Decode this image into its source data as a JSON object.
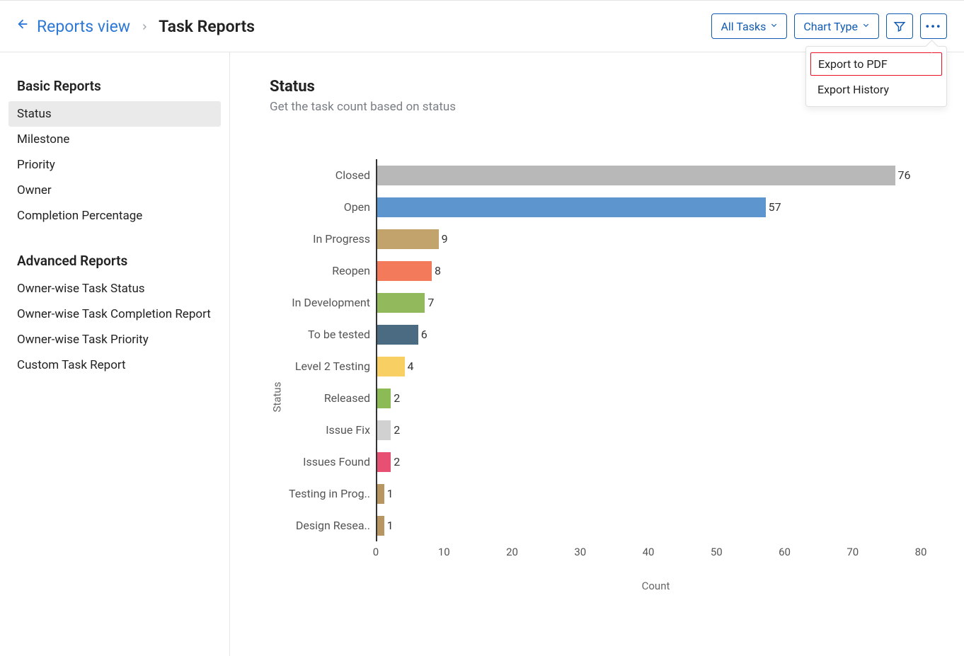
{
  "header": {
    "breadcrumb_link": "Reports view",
    "page_title": "Task Reports",
    "actions": {
      "all_tasks": "All Tasks",
      "chart_type": "Chart Type"
    },
    "menu": {
      "export_pdf": "Export to PDF",
      "export_history": "Export History"
    }
  },
  "sidebar": {
    "groups": [
      {
        "title": "Basic Reports",
        "items": [
          "Status",
          "Milestone",
          "Priority",
          "Owner",
          "Completion Percentage"
        ],
        "active_index": 0
      },
      {
        "title": "Advanced Reports",
        "items": [
          "Owner-wise Task Status",
          "Owner-wise Task Completion Report",
          "Owner-wise Task Priority",
          "Custom Task Report"
        ],
        "active_index": -1
      }
    ]
  },
  "chart_title": "Status",
  "chart_subtitle": "Get the task count based on status",
  "chart_data": {
    "type": "bar",
    "orientation": "horizontal",
    "title": "Status",
    "xlabel": "Count",
    "ylabel": "Status",
    "xlim": [
      0,
      80
    ],
    "xticks": [
      0,
      10,
      20,
      30,
      40,
      50,
      60,
      70,
      80
    ],
    "categories": [
      "Closed",
      "Open",
      "In Progress",
      "Reopen",
      "In Development",
      "To be tested",
      "Level 2 Testing",
      "Released",
      "Issue Fix",
      "Issues Found",
      "Testing in Prog..",
      "Design Resea.."
    ],
    "values": [
      76,
      57,
      9,
      8,
      7,
      6,
      4,
      2,
      2,
      2,
      1,
      1
    ],
    "colors": [
      "#b8b8b8",
      "#5d95cf",
      "#c2a36b",
      "#f37b5c",
      "#93b95d",
      "#4a6b82",
      "#f7cf63",
      "#8cbb55",
      "#d1d1d1",
      "#e85073",
      "#b79662",
      "#b79662"
    ]
  }
}
